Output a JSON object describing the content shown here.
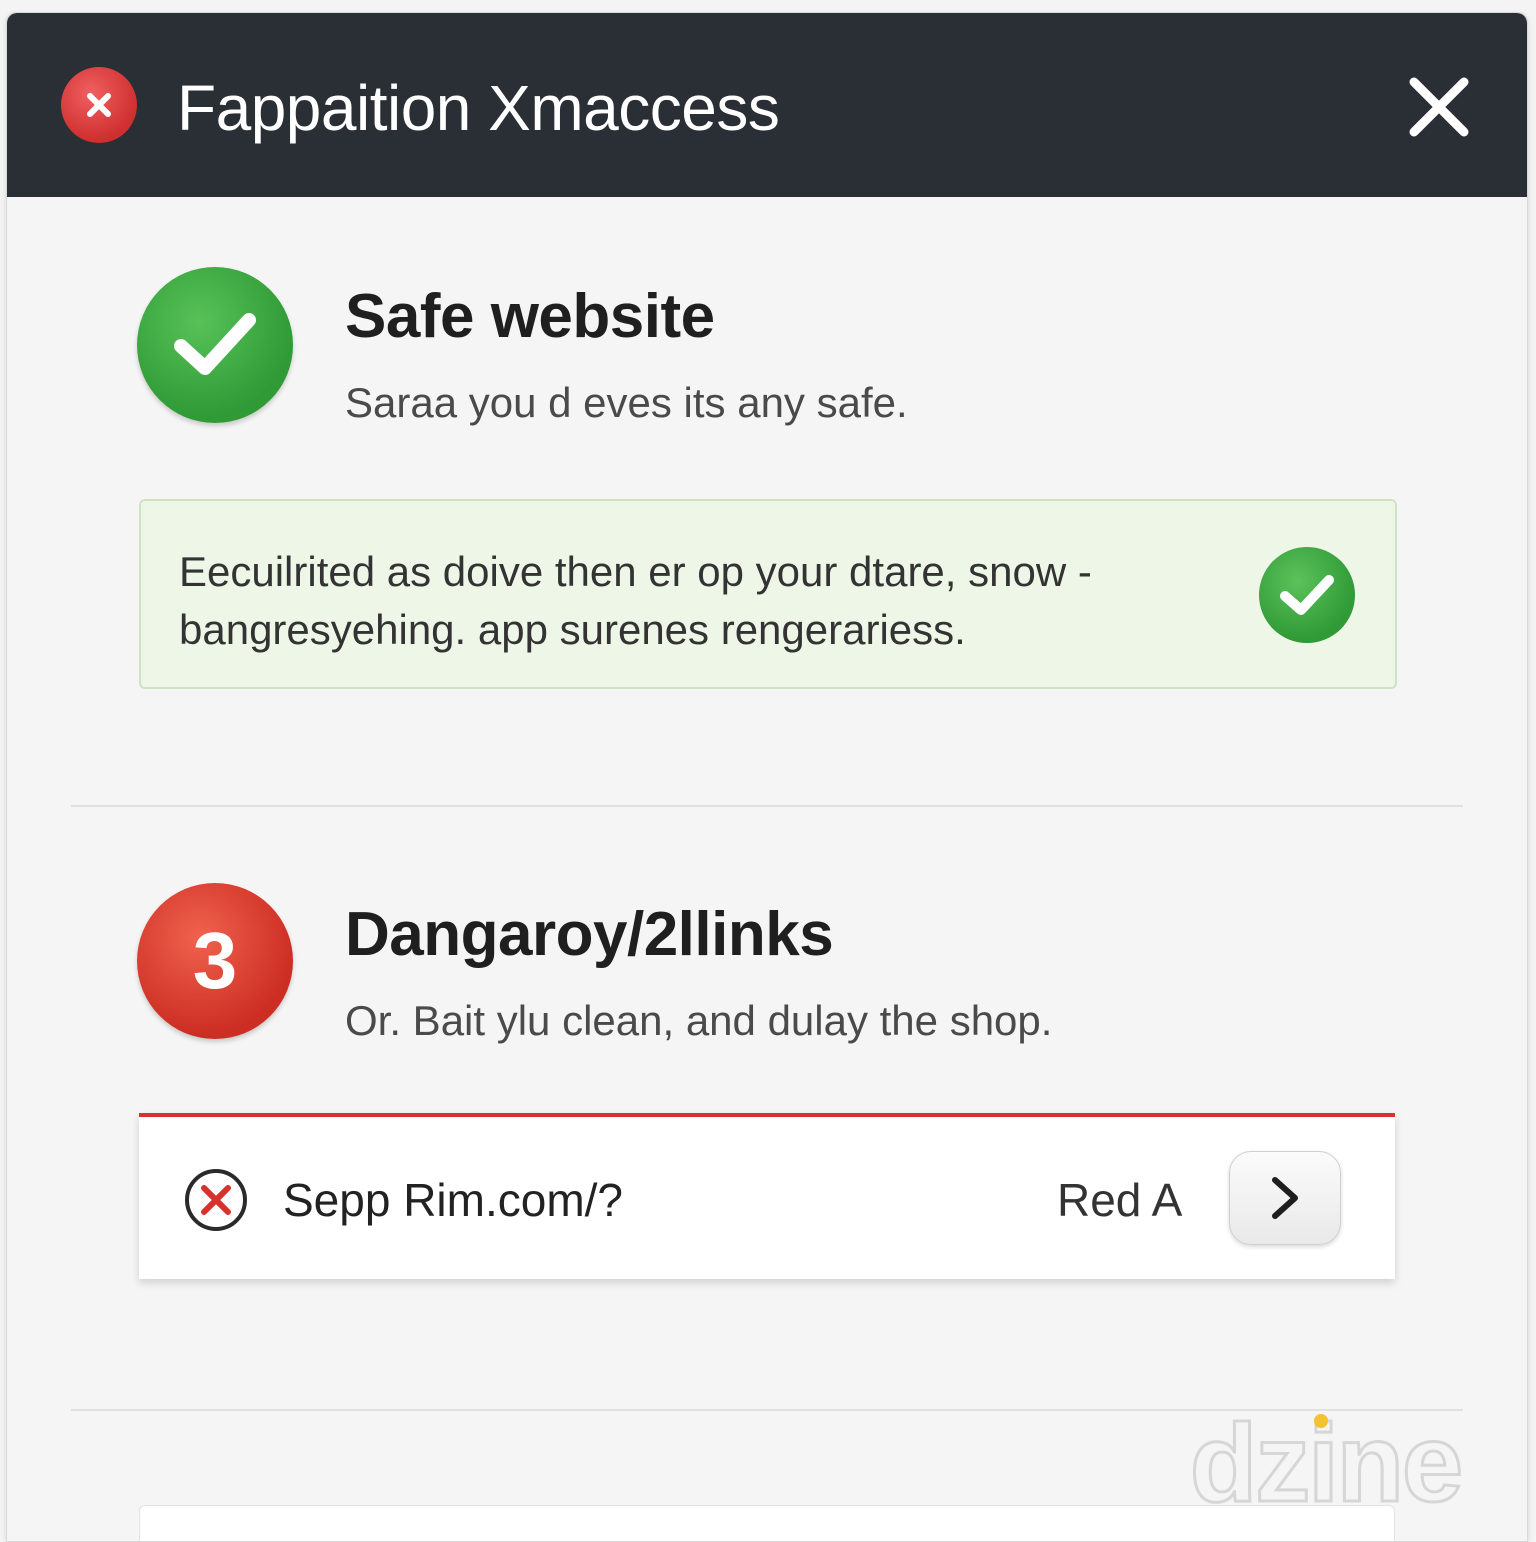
{
  "window": {
    "title": "Fappaition Xmaccess"
  },
  "safe_section": {
    "heading": "Safe website",
    "subtext": "Saraa you d eves its any safe.",
    "info_text": "Eecuilrited as doive then er op your dtare, snow - bangresyehing. app surenes rengerariess."
  },
  "danger_section": {
    "count": "3",
    "heading": "Dangaroy/2llinks",
    "subtext": "Or. Bait ylu clean, and dulay the shop.",
    "links": [
      {
        "url": "Sepp Rim.com/?",
        "status": "Red A"
      }
    ]
  },
  "watermark": "dzine",
  "colors": {
    "titlebar": "#2a2e35",
    "safe_green": "#2f9a36",
    "danger_red": "#cc2e23",
    "info_bg": "#eef6e8"
  },
  "icons": {
    "title_badge": "error-x-icon",
    "close": "close-icon",
    "safe": "checkmark-icon",
    "info": "checkmark-icon",
    "link_status": "circle-x-icon",
    "link_action": "chevron-right-icon"
  }
}
